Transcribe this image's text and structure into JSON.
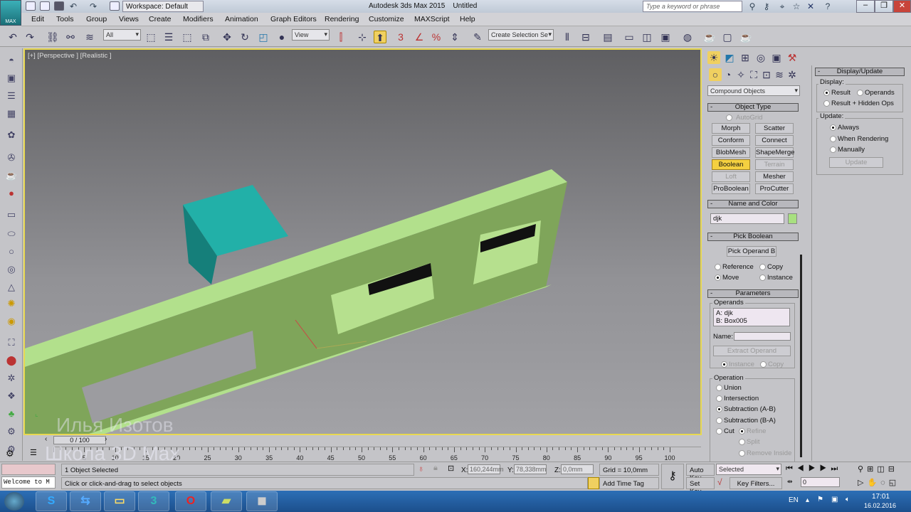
{
  "titlebar": {
    "workspace": "Workspace: Default",
    "title": "Autodesk 3ds Max 2015",
    "document": "Untitled",
    "search_placeholder": "Type a keyword or phrase",
    "logo": "MAX"
  },
  "menu": [
    "Edit",
    "Tools",
    "Group",
    "Views",
    "Create",
    "Modifiers",
    "Animation",
    "Graph Editors",
    "Rendering",
    "Customize",
    "MAXScript",
    "Help"
  ],
  "toolbar": {
    "selection_filter": "All",
    "ref_coord": "View",
    "selection_set": "Create Selection Se",
    "snaps": [
      "3",
      "%"
    ]
  },
  "viewport": {
    "label": "[+] [Perspective ] [Realistic ]",
    "watermark_line1": "Илья Изотов",
    "watermark_line2": "Школа 3D Max",
    "box_color": "#1a9a94",
    "object_color": "#a8d880"
  },
  "command_panel": {
    "category": "Compound Objects",
    "object_type": {
      "title": "Object Type",
      "autogrid": "AutoGrid",
      "buttons": [
        {
          "label": "Morph",
          "state": "normal"
        },
        {
          "label": "Scatter",
          "state": "normal"
        },
        {
          "label": "Conform",
          "state": "normal"
        },
        {
          "label": "Connect",
          "state": "normal"
        },
        {
          "label": "BlobMesh",
          "state": "normal"
        },
        {
          "label": "ShapeMerge",
          "state": "normal"
        },
        {
          "label": "Boolean",
          "state": "active"
        },
        {
          "label": "Terrain",
          "state": "disabled"
        },
        {
          "label": "Loft",
          "state": "disabled"
        },
        {
          "label": "Mesher",
          "state": "normal"
        },
        {
          "label": "ProBoolean",
          "state": "normal"
        },
        {
          "label": "ProCutter",
          "state": "normal"
        }
      ]
    },
    "name_and_color": {
      "title": "Name and Color",
      "name": "djk",
      "color": "#a8e080"
    },
    "pick_boolean": {
      "title": "Pick Boolean",
      "button": "Pick Operand B",
      "reference": "Reference",
      "copy": "Copy",
      "move": "Move",
      "instance": "Instance",
      "selected": "Move"
    },
    "parameters": {
      "title": "Parameters",
      "operands_label": "Operands",
      "operands": [
        "A: djk",
        "B: Box005"
      ],
      "name_label": "Name:",
      "name_value": "",
      "extract": "Extract Operand",
      "instance": "Instance",
      "copy": "Copy",
      "operation_label": "Operation",
      "operations": [
        "Union",
        "Intersection",
        "Subtraction (A-B)",
        "Subtraction (B-A)",
        "Cut"
      ],
      "selected_operation": "Subtraction (A-B)",
      "cut_options": [
        "Refine",
        "Split",
        "Remove Inside"
      ]
    }
  },
  "display_update": {
    "title": "Display/Update",
    "display_label": "Display:",
    "result": "Result",
    "operands": "Operands",
    "result_hidden": "Result + Hidden Ops",
    "update_label": "Update:",
    "always": "Always",
    "when_rendering": "When Rendering",
    "manually": "Manually",
    "update_button": "Update"
  },
  "timeline": {
    "slider": "0 / 100",
    "current_frame": 0,
    "ticks": [
      "0",
      "5",
      "10",
      "15",
      "20",
      "25",
      "30",
      "35",
      "40",
      "45",
      "50",
      "55",
      "60",
      "65",
      "70",
      "75",
      "80",
      "85",
      "90",
      "95",
      "100"
    ]
  },
  "status": {
    "selection": "1 Object Selected",
    "prompt": "Click or click-and-drag to select objects",
    "maxscript": "Welcome to M",
    "x": "160,244mm",
    "y": "78,338mm",
    "z": "0,0mm",
    "x_label": "X:",
    "y_label": "Y:",
    "z_label": "Z:",
    "grid": "Grid = 10,0mm",
    "add_time_tag": "Add Time Tag",
    "auto_key": "Auto Key",
    "set_key": "Set Key",
    "key_mode": "Selected",
    "key_filters": "Key Filters...",
    "frame": "0"
  },
  "taskbar": {
    "apps": [
      "start",
      "skype",
      "teamviewer",
      "explorer",
      "3ds-max",
      "opera",
      "app",
      "video"
    ],
    "lang": "EN",
    "time": "17:01",
    "date": "16.02.2016"
  }
}
